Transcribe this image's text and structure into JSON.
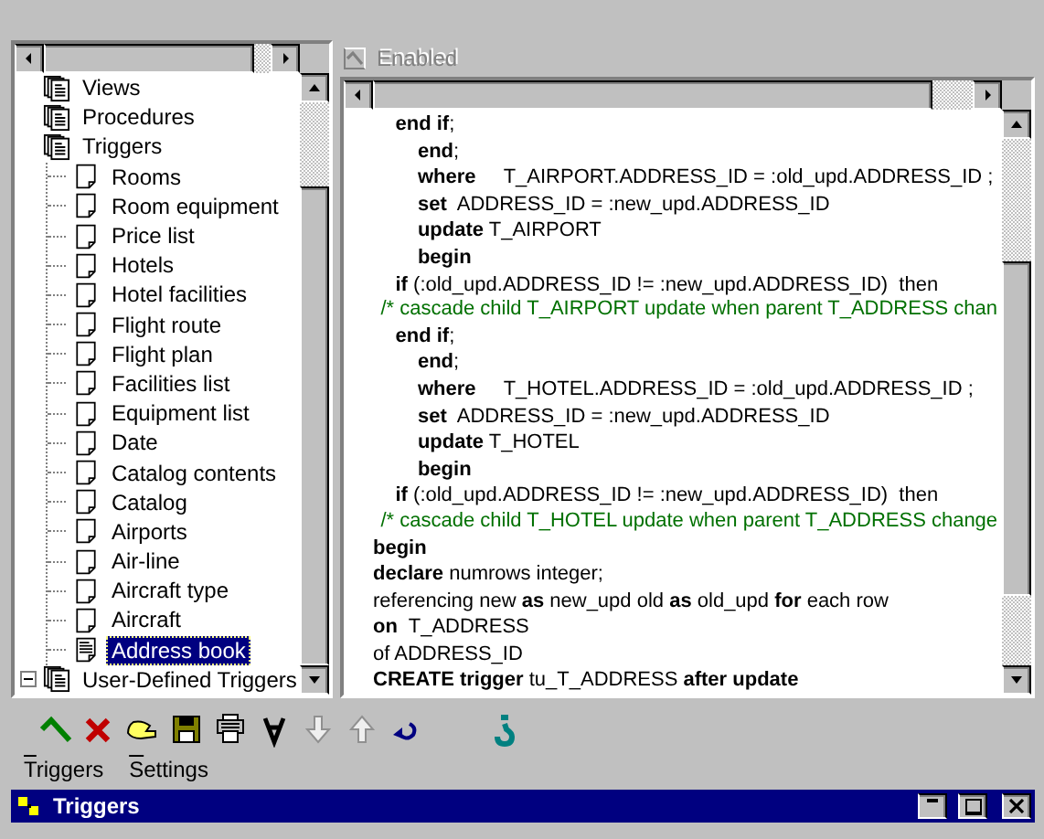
{
  "window": {
    "title": "Triggers"
  },
  "enabled": {
    "label": "Enabled",
    "checked": true,
    "disabled": true
  },
  "tree": [
    {
      "label": "Views",
      "kind": "group",
      "selected": false
    },
    {
      "label": "Procedures",
      "kind": "group",
      "selected": false
    },
    {
      "label": "Triggers",
      "kind": "group",
      "selected": false
    },
    {
      "label": "User-Defined Triggers",
      "kind": "group",
      "selected": false,
      "expanded": true,
      "children": [
        {
          "label": "Rooms",
          "kind": "trigger",
          "selected": false
        },
        {
          "label": "Room equipment",
          "kind": "trigger",
          "selected": false
        },
        {
          "label": "Price list",
          "kind": "trigger",
          "selected": false
        },
        {
          "label": "Hotels",
          "kind": "trigger",
          "selected": false
        },
        {
          "label": "Hotel facilities",
          "kind": "trigger",
          "selected": false
        },
        {
          "label": "Flight route",
          "kind": "trigger",
          "selected": false
        },
        {
          "label": "Flight plan",
          "kind": "trigger",
          "selected": false
        },
        {
          "label": "Facilities list",
          "kind": "trigger",
          "selected": false
        },
        {
          "label": "Equipment list",
          "kind": "trigger",
          "selected": false
        },
        {
          "label": "Date",
          "kind": "trigger",
          "selected": false
        },
        {
          "label": "Catalog contents",
          "kind": "trigger",
          "selected": false
        },
        {
          "label": "Catalog",
          "kind": "trigger",
          "selected": false
        },
        {
          "label": "Airports",
          "kind": "trigger",
          "selected": false
        },
        {
          "label": "Air-line",
          "kind": "trigger",
          "selected": false
        },
        {
          "label": "Aircraft type",
          "kind": "trigger",
          "selected": false
        },
        {
          "label": "Aircraft",
          "kind": "trigger",
          "selected": false
        },
        {
          "label": "Address book",
          "kind": "trigger",
          "selected": true
        }
      ]
    }
  ],
  "code": [
    {
      "kind": "code",
      "text": "    **end if**;"
    },
    {
      "kind": "code",
      "text": "        **end**;"
    },
    {
      "kind": "code",
      "text": "        **where**     T_AIRPORT.ADDRESS_ID = :old_upd.ADDRESS_ID ;"
    },
    {
      "kind": "code",
      "text": "        **set**  ADDRESS_ID = :new_upd.ADDRESS_ID"
    },
    {
      "kind": "code",
      "text": "        **update** T_AIRPORT"
    },
    {
      "kind": "code",
      "text": "        **begin**"
    },
    {
      "kind": "code",
      "text": "    **if** (:old_upd.ADDRESS_ID != :new_upd.ADDRESS_ID)  then"
    },
    {
      "kind": "comment",
      "text": "    /* cascade child T_AIRPORT update when parent T_ADDRESS chan"
    },
    {
      "kind": "code",
      "text": "    **end if**;"
    },
    {
      "kind": "code",
      "text": "        **end**;"
    },
    {
      "kind": "code",
      "text": "        **where**     T_HOTEL.ADDRESS_ID = :old_upd.ADDRESS_ID ;"
    },
    {
      "kind": "code",
      "text": "        **set**  ADDRESS_ID = :new_upd.ADDRESS_ID"
    },
    {
      "kind": "code",
      "text": "        **update** T_HOTEL"
    },
    {
      "kind": "code",
      "text": "        **begin**"
    },
    {
      "kind": "code",
      "text": "    **if** (:old_upd.ADDRESS_ID != :new_upd.ADDRESS_ID)  then"
    },
    {
      "kind": "comment",
      "text": "    /* cascade child T_HOTEL update when parent T_ADDRESS change"
    },
    {
      "kind": "code",
      "text": "**begin**"
    },
    {
      "kind": "code",
      "text": "**declare** numrows integer;"
    },
    {
      "kind": "code",
      "text": "referencing new **as** new_upd old **as** old_upd **for** each row"
    },
    {
      "kind": "code",
      "text": "**on**  T_ADDRESS"
    },
    {
      "kind": "code",
      "text": "of ADDRESS_ID"
    },
    {
      "kind": "code",
      "text": "**CREATE trigger** tu_T_ADDRESS **after update**"
    }
  ],
  "toolbar": [
    {
      "kind": "apply",
      "disabled": false
    },
    {
      "kind": "cancel",
      "disabled": false
    },
    {
      "kind": "edit",
      "disabled": false
    },
    {
      "kind": "save",
      "disabled": false
    },
    {
      "kind": "print",
      "disabled": false
    },
    {
      "kind": "font",
      "disabled": false
    },
    {
      "kind": "move-down",
      "disabled": true
    },
    {
      "kind": "move-up",
      "disabled": true
    },
    {
      "kind": "undo",
      "disabled": false
    },
    {
      "kind": "help",
      "disabled": false
    }
  ],
  "menu": [
    {
      "label": "Triggers"
    },
    {
      "label": "Settings"
    }
  ]
}
